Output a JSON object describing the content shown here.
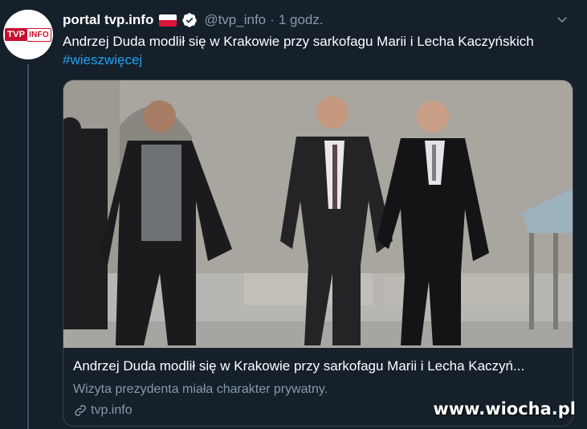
{
  "tweet": {
    "author_name": "portal tvp.info",
    "handle": "@tvp_info",
    "separator": "·",
    "time": "1 godz.",
    "text": "Andrzej Duda modlił się w Krakowie przy sarkofagu Marii i Lecha Kaczyńskich",
    "hashtag": "#wieszwięcej",
    "avatar_logo_left": "TVP",
    "avatar_logo_right": "INFO",
    "icons": [
      "poland-flag-icon",
      "verified-badge-icon",
      "chevron-down-icon",
      "link-icon"
    ]
  },
  "card": {
    "title": "Andrzej Duda modlił się w Krakowie przy sarkofagu Marii i Lecha Kaczyń...",
    "description": "Wizyta prezydenta miała charakter prywatny.",
    "domain": "tvp.info"
  },
  "watermark": "www.wiocha.pl",
  "colors": {
    "background": "#15202b",
    "link": "#1da1f2",
    "secondary_text": "#8899a6",
    "border": "#38444d"
  }
}
